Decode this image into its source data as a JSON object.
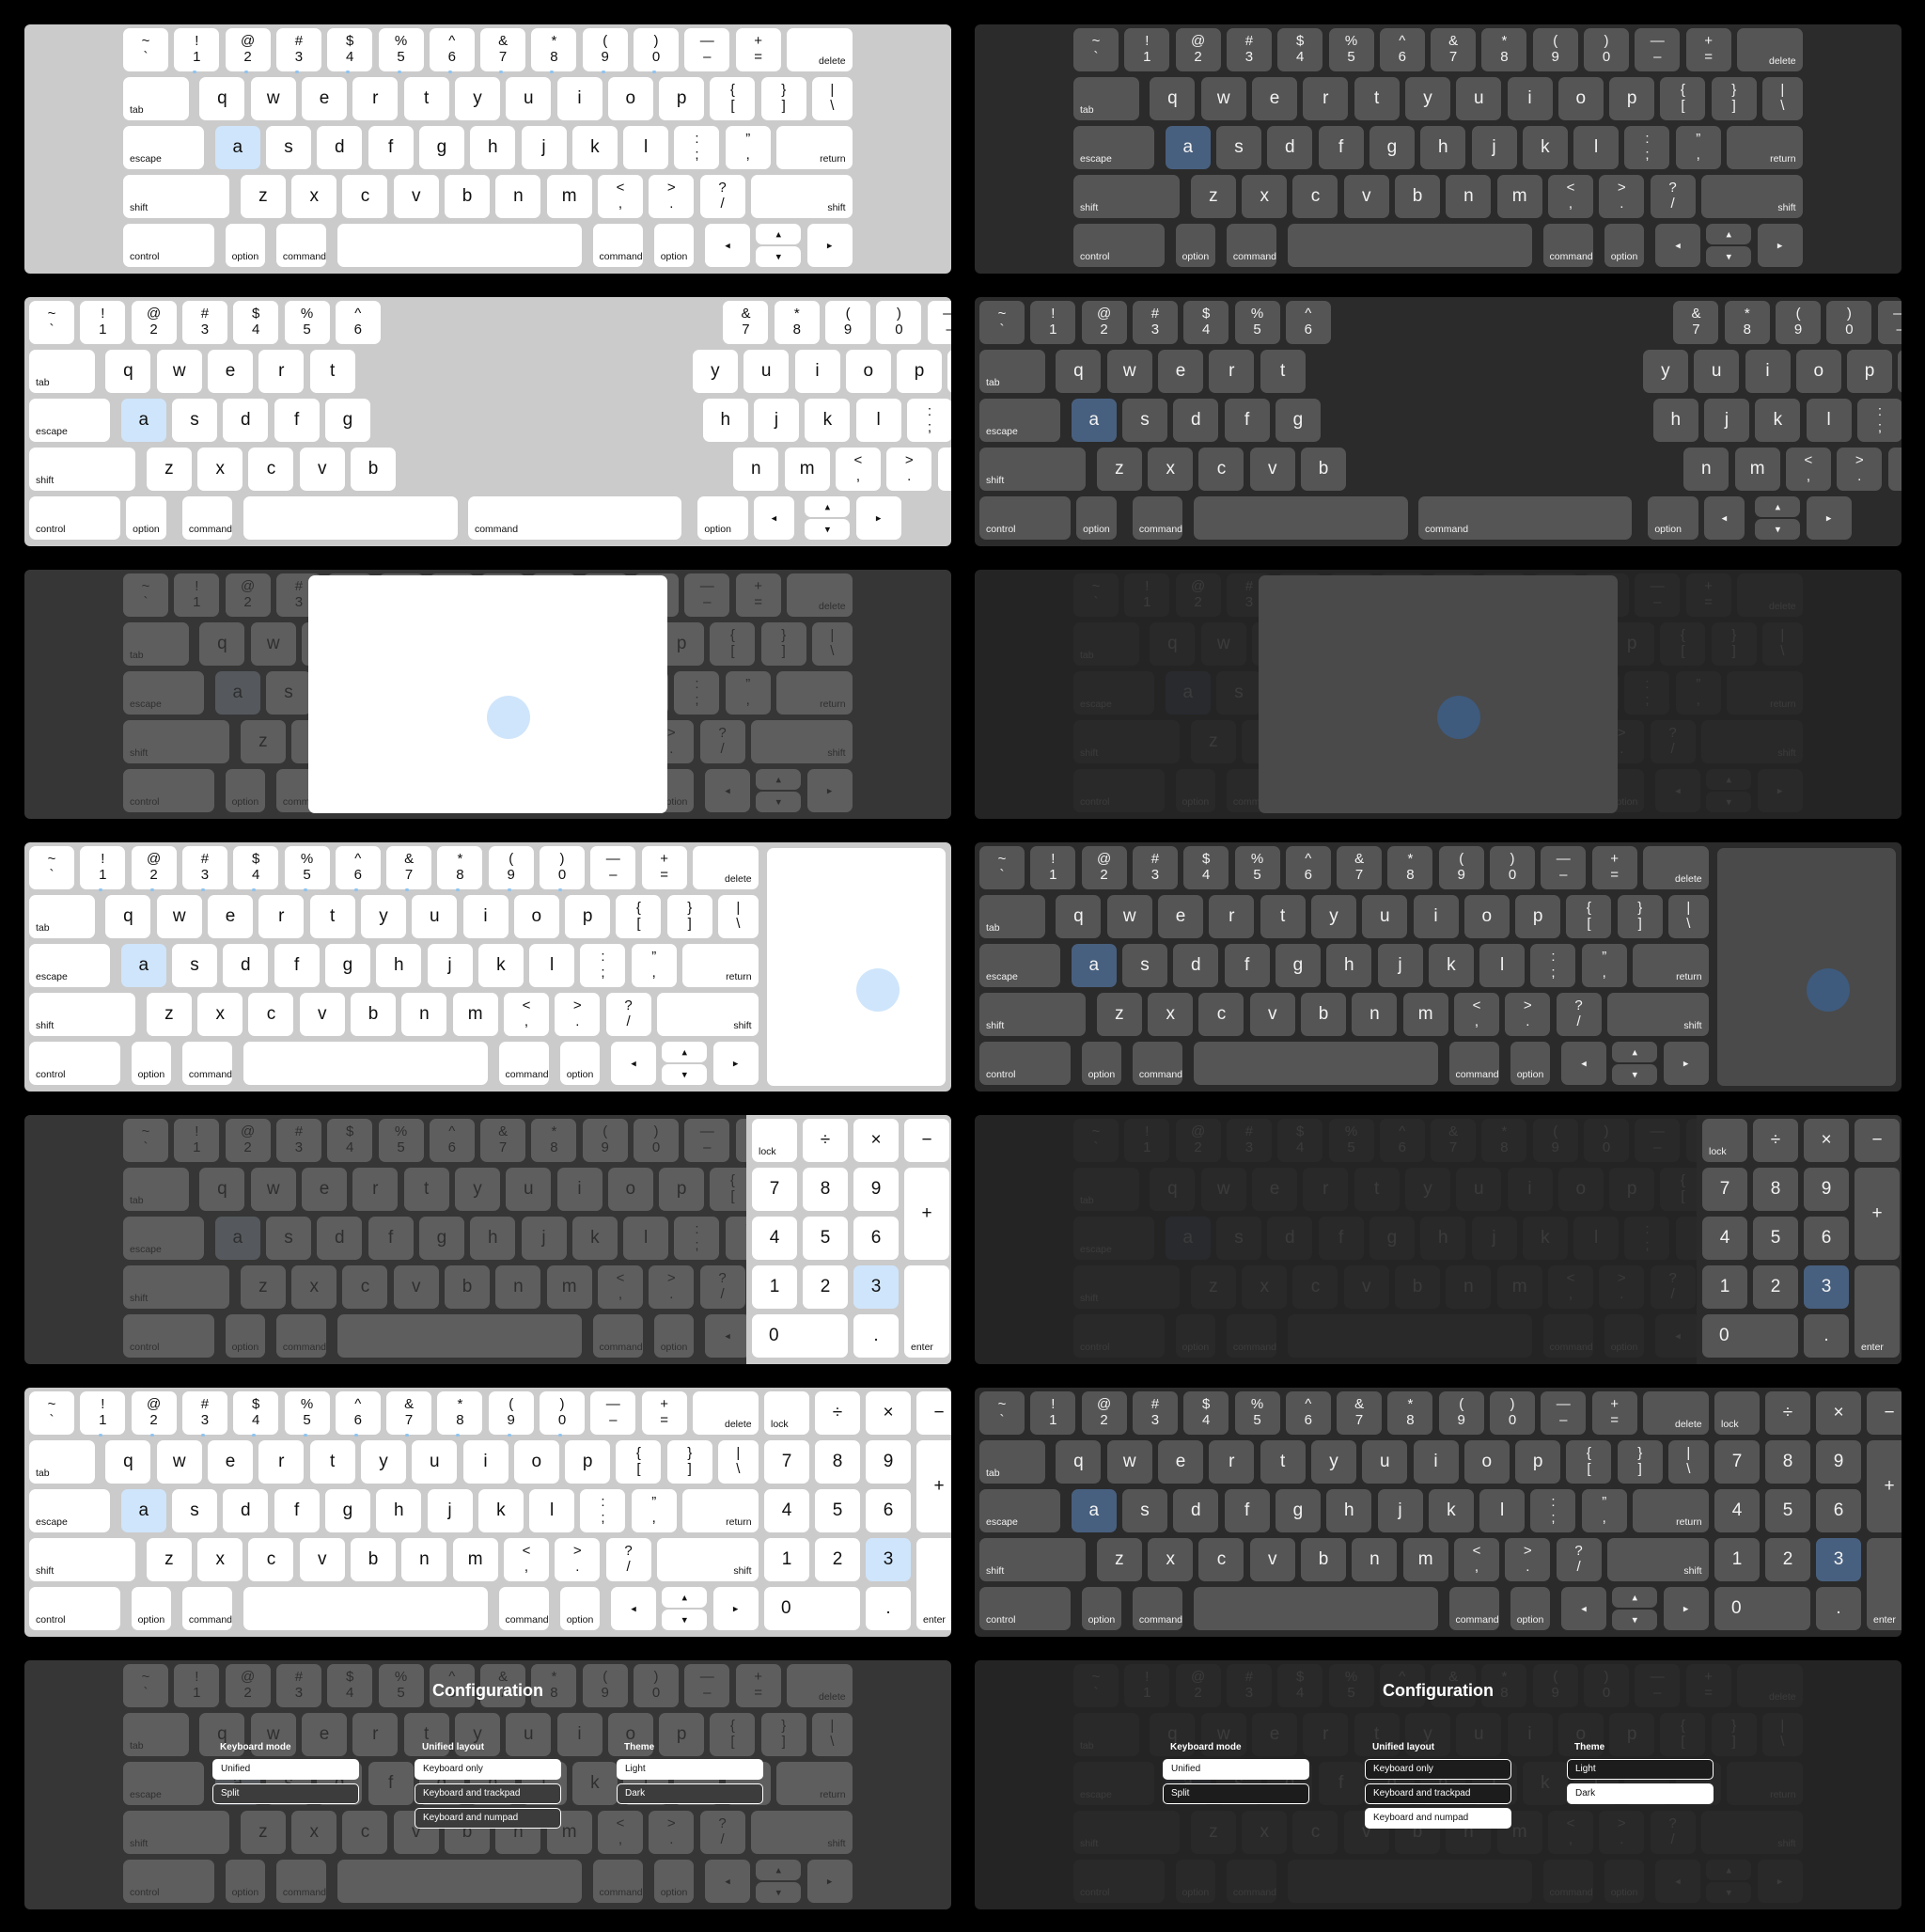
{
  "keyboard": {
    "row1": [
      {
        "top": "~",
        "bot": "`"
      },
      {
        "top": "!",
        "bot": "1"
      },
      {
        "top": "@",
        "bot": "2"
      },
      {
        "top": "#",
        "bot": "3"
      },
      {
        "top": "$",
        "bot": "4"
      },
      {
        "top": "%",
        "bot": "5"
      },
      {
        "top": "^",
        "bot": "6"
      },
      {
        "top": "&",
        "bot": "7"
      },
      {
        "top": "*",
        "bot": "8"
      },
      {
        "top": "(",
        "bot": "9"
      },
      {
        "top": ")",
        "bot": "0"
      },
      {
        "top": "—",
        "bot": "–"
      },
      {
        "top": "+",
        "bot": "="
      },
      {
        "label": "delete",
        "align": "r"
      }
    ],
    "row2": [
      {
        "label": "tab",
        "align": "l"
      },
      {
        "single": "q"
      },
      {
        "single": "w"
      },
      {
        "single": "e"
      },
      {
        "single": "r"
      },
      {
        "single": "t"
      },
      {
        "single": "y"
      },
      {
        "single": "u"
      },
      {
        "single": "i"
      },
      {
        "single": "o"
      },
      {
        "single": "p"
      },
      {
        "top": "{",
        "bot": "["
      },
      {
        "top": "}",
        "bot": "]"
      },
      {
        "top": "|",
        "bot": "\\"
      }
    ],
    "row3": [
      {
        "label": "escape",
        "align": "l"
      },
      {
        "single": "a",
        "hl": true
      },
      {
        "single": "s"
      },
      {
        "single": "d"
      },
      {
        "single": "f"
      },
      {
        "single": "g"
      },
      {
        "single": "h"
      },
      {
        "single": "j"
      },
      {
        "single": "k"
      },
      {
        "single": "l"
      },
      {
        "top": ":",
        "bot": ";"
      },
      {
        "top": "”",
        "bot": ","
      },
      {
        "label": "return",
        "align": "r"
      }
    ],
    "row4": [
      {
        "label": "shift",
        "align": "l"
      },
      {
        "single": "z"
      },
      {
        "single": "x"
      },
      {
        "single": "c"
      },
      {
        "single": "v"
      },
      {
        "single": "b"
      },
      {
        "single": "n"
      },
      {
        "single": "m"
      },
      {
        "top": "<",
        "bot": ","
      },
      {
        "top": ">",
        "bot": "."
      },
      {
        "top": "?",
        "bot": "/"
      },
      {
        "label": "shift",
        "align": "r"
      }
    ],
    "row5": [
      {
        "label": "control",
        "align": "l"
      },
      {
        "label": "option",
        "align": "c"
      },
      {
        "label": "command",
        "align": "c"
      },
      {
        "space": true
      },
      {
        "label": "command",
        "align": "c"
      },
      {
        "label": "option",
        "align": "c"
      },
      {
        "arrow": "◂"
      },
      {
        "updown": [
          "▴",
          "▾"
        ]
      },
      {
        "arrow": "▸"
      }
    ]
  },
  "numpad": {
    "lock": "lock",
    "divide": "÷",
    "multiply": "×",
    "minus": "−",
    "seven": "7",
    "eight": "8",
    "nine": "9",
    "plus": "+",
    "four": "4",
    "five": "5",
    "six": "6",
    "one": "1",
    "two": "2",
    "three": "3",
    "zero": "0",
    "dot": ".",
    "enter": "enter"
  },
  "config": {
    "title": "Configuration",
    "groups": [
      {
        "title": "Keyboard mode",
        "options": [
          "Unified",
          "Split"
        ]
      },
      {
        "title": "Unified layout",
        "options": [
          "Keyboard only",
          "Keyboard and trackpad",
          "Keyboard and numpad"
        ]
      },
      {
        "title": "Theme",
        "options": [
          "Light",
          "Dark"
        ]
      }
    ],
    "selected_light": {
      "mode": "Unified",
      "layout": "Keyboard only",
      "theme": "Light"
    },
    "selected_dark": {
      "mode": "Unified",
      "layout": "Keyboard and numpad",
      "theme": "Dark"
    }
  },
  "themes": {
    "light_bg": "#cbcbcb",
    "light_key": "#ffffff",
    "light_highlight": "#cfe5fb",
    "dark_bg": "#2b2b2b",
    "dark_key": "#555555",
    "dark_highlight": "#48607f"
  },
  "screens": [
    {
      "theme": "light",
      "variant": "unified"
    },
    {
      "theme": "dark",
      "variant": "unified"
    },
    {
      "theme": "light",
      "variant": "split"
    },
    {
      "theme": "dark",
      "variant": "split"
    },
    {
      "theme": "light",
      "variant": "trackpad-overlay"
    },
    {
      "theme": "dark",
      "variant": "trackpad-overlay"
    },
    {
      "theme": "light",
      "variant": "keyboard-and-trackpad"
    },
    {
      "theme": "dark",
      "variant": "keyboard-and-trackpad"
    },
    {
      "theme": "light",
      "variant": "numpad-overlay"
    },
    {
      "theme": "dark",
      "variant": "numpad-overlay"
    },
    {
      "theme": "light",
      "variant": "keyboard-and-numpad"
    },
    {
      "theme": "dark",
      "variant": "keyboard-and-numpad"
    },
    {
      "theme": "light",
      "variant": "configuration"
    },
    {
      "theme": "dark",
      "variant": "configuration"
    }
  ]
}
